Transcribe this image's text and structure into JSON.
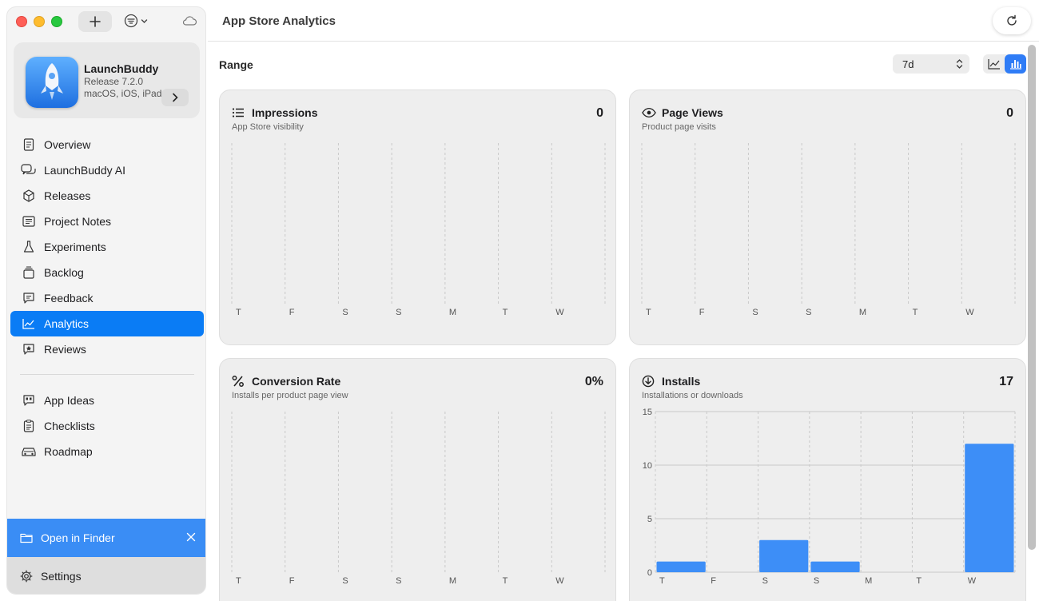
{
  "window": {
    "title": "App Store Analytics"
  },
  "app": {
    "name": "LaunchBuddy",
    "release": "Release 7.2.0",
    "platforms": "macOS, iOS, iPadOS"
  },
  "sidebar": {
    "items": [
      {
        "label": "Overview",
        "icon": "document-icon"
      },
      {
        "label": "LaunchBuddy AI",
        "icon": "chat-bubbles-icon"
      },
      {
        "label": "Releases",
        "icon": "box-icon"
      },
      {
        "label": "Project Notes",
        "icon": "note-icon"
      },
      {
        "label": "Experiments",
        "icon": "flask-icon"
      },
      {
        "label": "Backlog",
        "icon": "stack-icon"
      },
      {
        "label": "Feedback",
        "icon": "message-icon"
      },
      {
        "label": "Analytics",
        "icon": "chart-icon",
        "active": true
      },
      {
        "label": "Reviews",
        "icon": "star-bubble-icon"
      }
    ],
    "secondary_items": [
      {
        "label": "App Ideas",
        "icon": "ideas-icon"
      },
      {
        "label": "Checklists",
        "icon": "clipboard-icon"
      },
      {
        "label": "Roadmap",
        "icon": "car-icon"
      }
    ],
    "finder_label": "Open in Finder",
    "settings_label": "Settings"
  },
  "toolbar": {
    "range_label": "Range",
    "range_value": "7d",
    "view_mode": "bar"
  },
  "colors": {
    "accent": "#0a7cf5",
    "bar": "#3d8ef7",
    "finder_bar": "#3a8df5"
  },
  "cards": [
    {
      "title": "Impressions",
      "subtitle": "App Store visibility",
      "value": "0",
      "icon": "list-icon"
    },
    {
      "title": "Page Views",
      "subtitle": "Product page visits",
      "value": "0",
      "icon": "eye-icon"
    },
    {
      "title": "Conversion Rate",
      "subtitle": "Installs per product page view",
      "value": "0%",
      "icon": "percent-icon"
    },
    {
      "title": "Installs",
      "subtitle": "Installations or downloads",
      "value": "17",
      "icon": "download-circle-icon"
    }
  ],
  "chart_data": [
    {
      "type": "bar",
      "title": "Impressions",
      "categories": [
        "T",
        "F",
        "S",
        "S",
        "M",
        "T",
        "W"
      ],
      "values": [],
      "grid": true
    },
    {
      "type": "bar",
      "title": "Page Views",
      "categories": [
        "T",
        "F",
        "S",
        "S",
        "M",
        "T",
        "W"
      ],
      "values": [],
      "grid": true
    },
    {
      "type": "bar",
      "title": "Conversion Rate",
      "categories": [
        "T",
        "F",
        "S",
        "S",
        "M",
        "T",
        "W"
      ],
      "values": [],
      "grid": true
    },
    {
      "type": "bar",
      "title": "Installs",
      "categories": [
        "T",
        "F",
        "S",
        "S",
        "M",
        "T",
        "W"
      ],
      "values": [
        1,
        0,
        3,
        1,
        0,
        0,
        12
      ],
      "ylim": [
        0,
        15
      ],
      "yticks": [
        0,
        5,
        10,
        15
      ],
      "grid": true
    }
  ]
}
